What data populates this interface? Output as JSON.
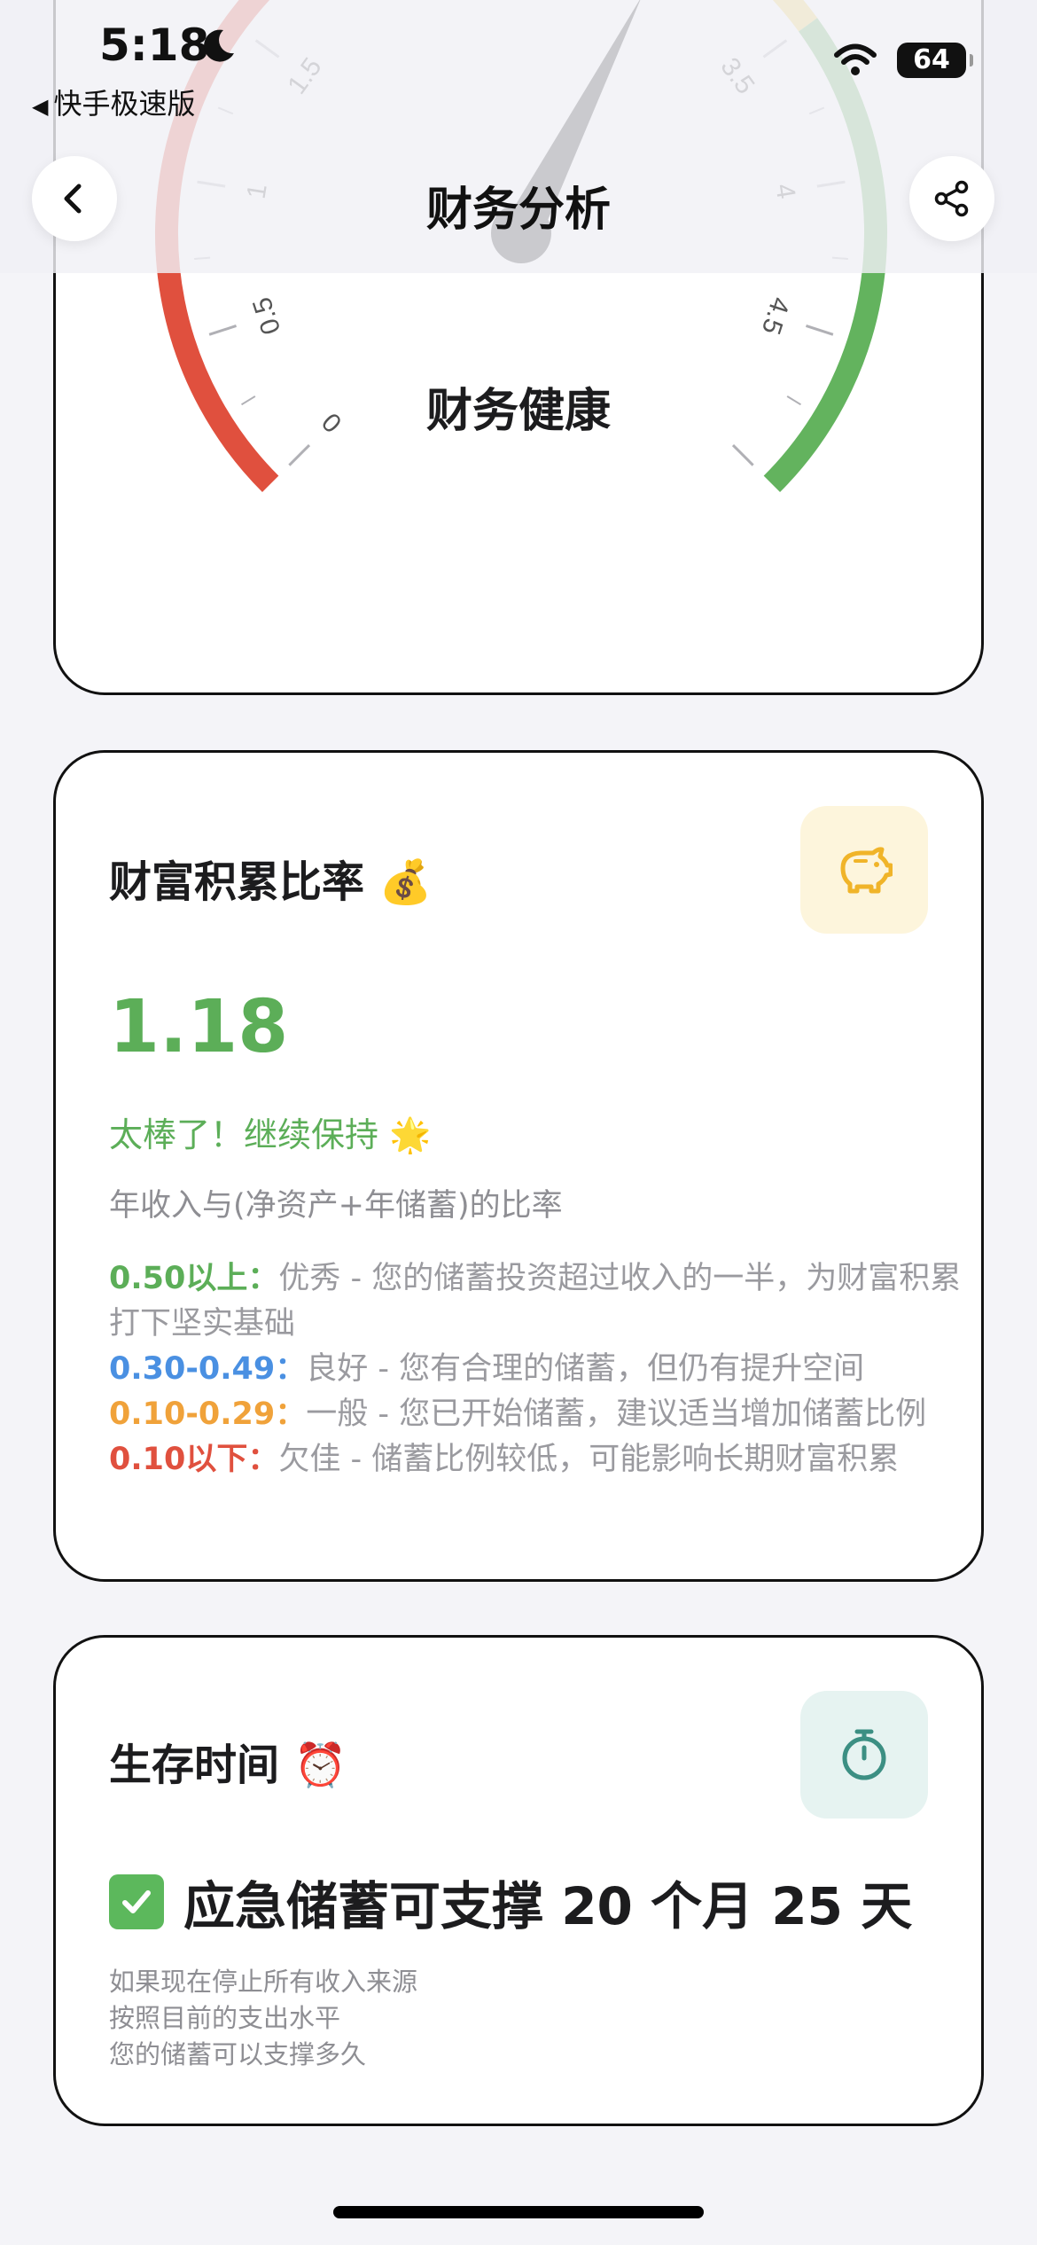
{
  "status_bar": {
    "time": "5:18",
    "back_app": "快手极速版",
    "battery": "64"
  },
  "nav": {
    "title": "财务分析",
    "back_icon": "chevron-left-icon",
    "share_icon": "share-icon"
  },
  "gauge": {
    "title": "财务健康",
    "min": 0,
    "max": 5,
    "value": 3.0,
    "tick_labels": [
      "0",
      "0.5",
      "1",
      "1.5",
      "3.5",
      "4",
      "4.5"
    ],
    "colors": {
      "red": "#e0503e",
      "yellow": "#f2d058",
      "green": "#63b35e"
    }
  },
  "wealth_card": {
    "title": "财富积累比率",
    "title_emoji": "💰",
    "icon": "piggy-bank-icon",
    "value": "1.18",
    "praise": "太棒了！继续保持 🌟",
    "description": "年收入与(净资产+年储蓄)的比率",
    "scale": [
      {
        "key": "0.50以上：",
        "text": "优秀 - 您的储蓄投资超过收入的一半，为财富积累打下坚实基础",
        "color": "green"
      },
      {
        "key": "0.30-0.49：",
        "text": "良好 - 您有合理的储蓄，但仍有提升空间",
        "color": "blue"
      },
      {
        "key": "0.10-0.29：",
        "text": "一般 - 您已开始储蓄，建议适当增加储蓄比例",
        "color": "orange"
      },
      {
        "key": "0.10以下：",
        "text": "欠佳 - 储蓄比例较低，可能影响长期财富积累",
        "color": "red"
      }
    ]
  },
  "survival_card": {
    "title": "生存时间",
    "title_emoji": "⏰",
    "icon": "stopwatch-icon",
    "status_icon": "check-icon",
    "summary": "应急储蓄可支撑 20 个月 25 天",
    "notes": [
      "如果现在停止所有收入来源",
      "按照目前的支出水平",
      "您的储蓄可以支撑多久"
    ]
  },
  "colors": {
    "accent_green": "#5cae58",
    "piggy_bg": "#fdf5dc",
    "piggy_fg": "#f0b429",
    "timer_bg": "#e6f3f1",
    "timer_fg": "#3c8f83"
  }
}
